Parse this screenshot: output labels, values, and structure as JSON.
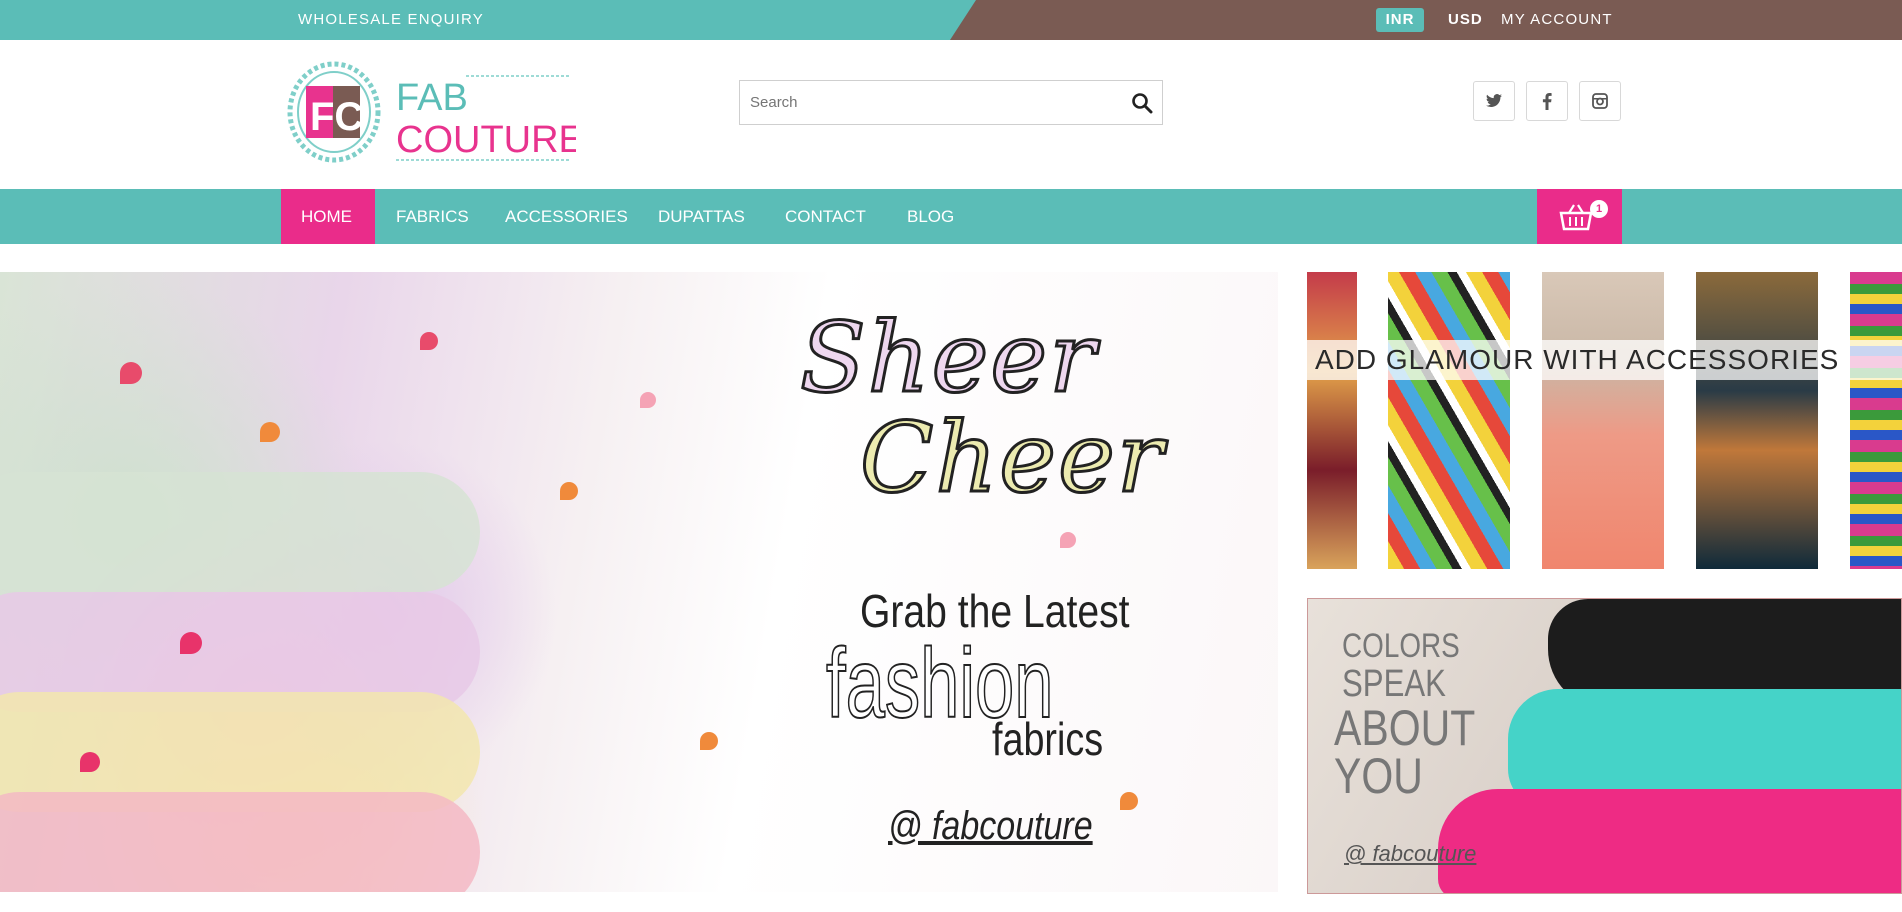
{
  "topbar": {
    "wholesale": "WHOLESALE ENQUIRY",
    "currencies": [
      "INR",
      "USD"
    ],
    "account": "MY ACCOUNT"
  },
  "logo": {
    "line1": "FAB",
    "line2": "COUTURE",
    "mark": "FC"
  },
  "search": {
    "placeholder": "Search"
  },
  "social": [
    "twitter-icon",
    "facebook-icon",
    "instagram-icon"
  ],
  "nav": {
    "items": [
      "HOME",
      "FABRICS",
      "ACCESSORIES",
      "DUPATTAS",
      "CONTACT",
      "BLOG"
    ],
    "active": "HOME"
  },
  "cart": {
    "count": "1"
  },
  "hero": {
    "line1": "Sheer",
    "line2": "Cheer",
    "line3": "Grab the Latest",
    "line4": "fashion",
    "line5": "fabrics",
    "handle": "@ fabcouture"
  },
  "banner_accessories": {
    "text": "ADD GLAMOUR WITH ACCESSORIES"
  },
  "banner_colors": {
    "line1": "COLORS",
    "line2": "SPEAK",
    "line3": "ABOUT",
    "line4": "YOU",
    "handle": "@ fabcouture"
  },
  "colors": {
    "teal": "#5bbdb7",
    "brown": "#7a5b53",
    "pink": "#ea2c8a"
  }
}
